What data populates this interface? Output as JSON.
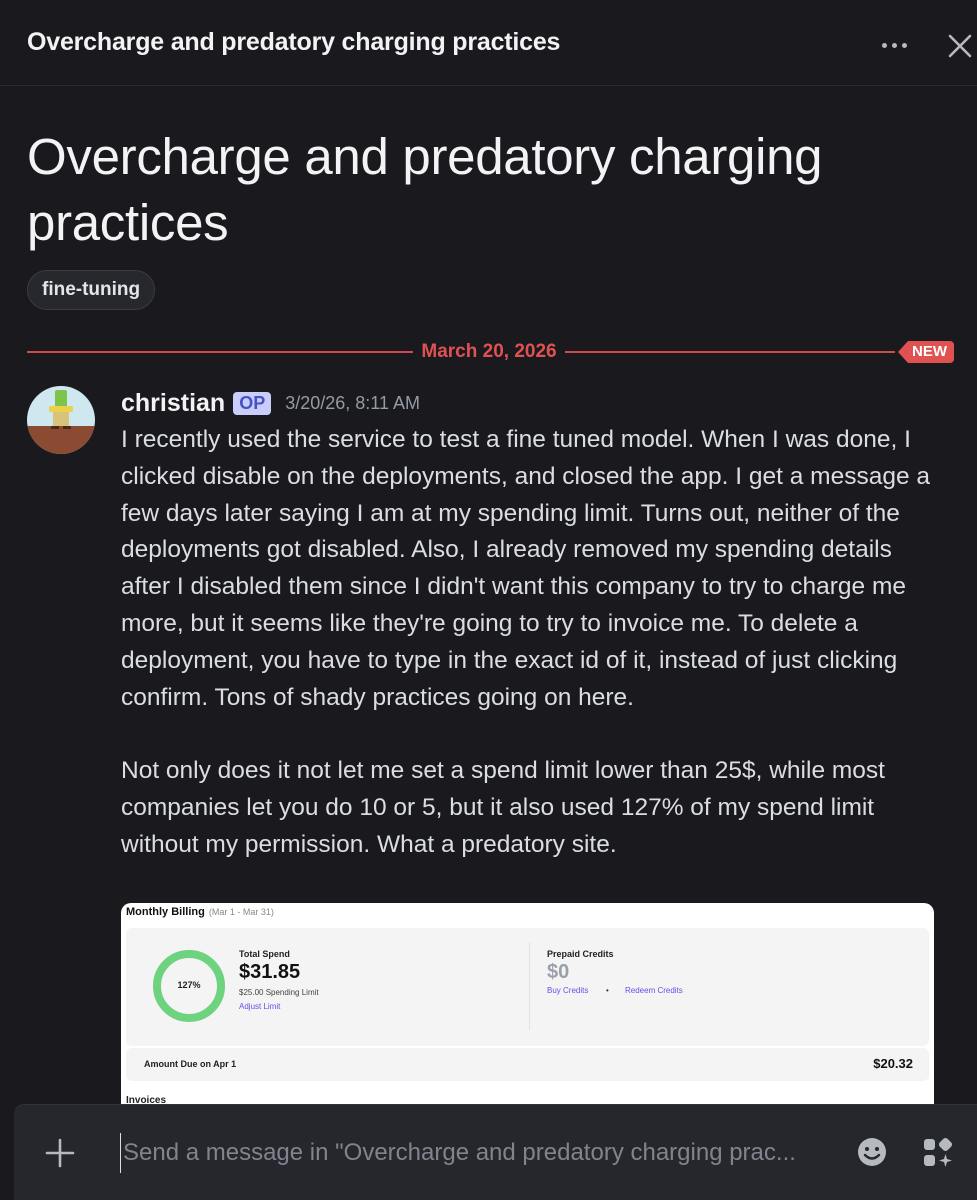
{
  "header": {
    "title": "Overcharge and predatory charging practices",
    "more_icon": "more-horizontal-icon",
    "close_icon": "close-icon"
  },
  "thread": {
    "title": "Overcharge and predatory charging practices",
    "tag": "fine-tuning"
  },
  "divider": {
    "date": "March 20, 2026",
    "new_label": "NEW",
    "color": "#e05252"
  },
  "message": {
    "username": "christian",
    "op_badge": "OP",
    "timestamp": "3/20/26, 8:11 AM",
    "body": "I recently used the service to test a fine tuned model. When I was done, I clicked disable on the deployments, and closed the app. I get a message a few days later saying I am at my spending limit. Turns out, neither of the deployments got disabled. Also, I already removed my spending details after I disabled them since I didn't want this company to try to charge me more, but it seems like they're going to try to invoice me. To delete a deployment, you have to type in the exact id of it, instead of just clicking confirm. Tons of shady practices going on here.\n\nNot only does it not let me set a spend limit lower than 25$, while most companies let you do 10 or 5, but it also used 127% of my spend limit without my permission. What a predatory site."
  },
  "attachment": {
    "title": "Monthly Billing",
    "range": "(Mar 1 - Mar 31)",
    "ring_label": "127%",
    "ring_fraction": 1.0,
    "total_spend_label": "Total Spend",
    "total_spend_value": "$31.85",
    "spending_limit": "$25.00 Spending Limit",
    "adjust_limit": "Adjust Limit",
    "prepaid_label": "Prepaid Credits",
    "prepaid_value": "$0",
    "buy_credits": "Buy Credits",
    "separator": "•",
    "redeem_credits": "Redeem Credits",
    "amount_due_label": "Amount Due on Apr 1",
    "amount_due_value": "$20.32",
    "invoices_label": "Invoices"
  },
  "composer": {
    "placeholder": "Send a message in \"Overcharge and predatory charging prac...",
    "plus_icon": "plus-icon",
    "emoji_icon": "emoji-icon",
    "apps_icon": "apps-icon"
  },
  "colors": {
    "background": "#1a1a1e",
    "accent_red": "#e05252",
    "ring_green": "#6dd37f"
  }
}
